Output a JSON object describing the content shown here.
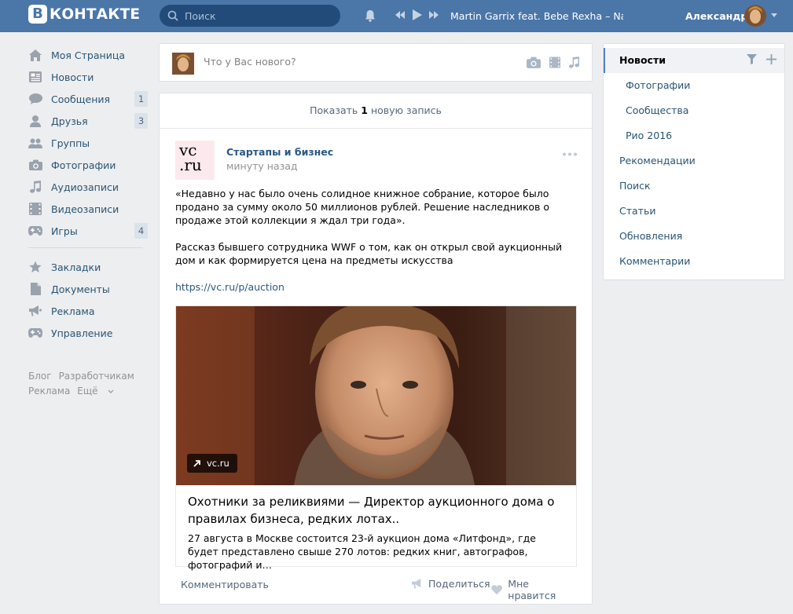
{
  "header": {
    "logo_letter": "В",
    "logo_text": "КОНТАКТЕ",
    "search_placeholder": "Поиск",
    "track": "Martin Garrix feat. Bebe Rexha – Nam…",
    "user_name": "Александр"
  },
  "leftnav": {
    "items": [
      {
        "label": "Моя Страница",
        "icon": "home-icon"
      },
      {
        "label": "Новости",
        "icon": "news-icon"
      },
      {
        "label": "Сообщения",
        "icon": "messages-icon",
        "badge": "1"
      },
      {
        "label": "Друзья",
        "icon": "friends-icon",
        "badge": "3"
      },
      {
        "label": "Группы",
        "icon": "groups-icon"
      },
      {
        "label": "Фотографии",
        "icon": "camera-icon"
      },
      {
        "label": "Аудиозаписи",
        "icon": "music-icon"
      },
      {
        "label": "Видеозаписи",
        "icon": "video-icon"
      },
      {
        "label": "Игры",
        "icon": "gamepad-icon",
        "badge": "4"
      }
    ],
    "items2": [
      {
        "label": "Закладки",
        "icon": "star-icon"
      },
      {
        "label": "Документы",
        "icon": "document-icon"
      },
      {
        "label": "Реклама",
        "icon": "megaphone-icon"
      },
      {
        "label": "Управление",
        "icon": "gamepad-icon"
      }
    ],
    "footer": {
      "blog": "Блог",
      "developers": "Разработчикам",
      "ads": "Реклама",
      "more": "Ещё"
    }
  },
  "postbox": {
    "placeholder": "Что у Вас нового?"
  },
  "feed": {
    "show_new_prefix": "Показать",
    "show_new_count": "1",
    "show_new_suffix": "новую запись",
    "post": {
      "logo_text_1": "vc",
      "logo_text_2": ".ru",
      "author": "Стартапы и бизнес",
      "time": "минуту назад",
      "text_1": "«Недавно у нас было очень солидное книжное собрание, которое было продано за сумму около 50 миллионов рублей. Решение наследников о продаже этой коллекции я ждал три года».",
      "text_2": "Рассказ бывшего сотрудника WWF о том, как он открыл свой аукционный дом и как формируется цена на предметы искусства",
      "link": "https://vc.ru/p/auction",
      "attachment": {
        "source": "vc.ru",
        "title": "Охотники за реликвиями — Директор аукционного дома о правилах бизнеса, редких лотах..",
        "description": "27 августа в Москве состоится 23-й аукцион дома «Литфонд», где будет представлено свыше 270 лотов: редких книг, автографов, фотографий и…"
      },
      "actions": {
        "comment": "Комментировать",
        "share": "Поделиться",
        "like": "Мне нравится"
      }
    }
  },
  "rightmenu": {
    "items": [
      {
        "label": "Новости",
        "active": true
      },
      {
        "label": "Фотографии",
        "sub": true
      },
      {
        "label": "Сообщества",
        "sub": true
      },
      {
        "label": "Рио 2016",
        "sub": true
      },
      {
        "label": "Рекомендации"
      },
      {
        "label": "Поиск"
      },
      {
        "label": "Статьи"
      },
      {
        "label": "Обновления"
      },
      {
        "label": "Комментарии"
      }
    ]
  },
  "colors": {
    "header_bg": "#4a76a8",
    "link": "#2a5885",
    "page_bg": "#edeef0"
  }
}
